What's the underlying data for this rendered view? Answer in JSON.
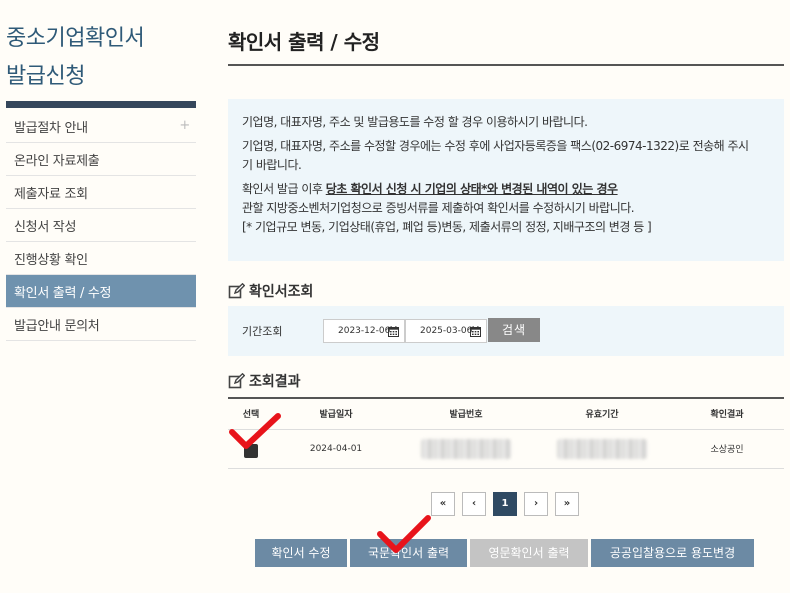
{
  "sidebar": {
    "title_line1": "중소기업확인서",
    "title_line2": "발급신청",
    "plus": "+",
    "items": [
      {
        "label": "발급절차 안내"
      },
      {
        "label": "온라인 자료제출"
      },
      {
        "label": "제출자료 조회"
      },
      {
        "label": "신청서 작성"
      },
      {
        "label": "진행상황 확인"
      },
      {
        "label": "확인서 출력 / 수정"
      },
      {
        "label": "발급안내 문의처"
      }
    ]
  },
  "main": {
    "title": "확인서 출력 / 수정",
    "notice": {
      "p1": "기업명, 대표자명, 주소 및 발급용도를 수정 할 경우 이용하시기 바랍니다.",
      "p2_line1": "기업명, 대표자명, 주소를 수정할 경우에는 수정 후에 사업자등록증을 팩스(02-6974-1322)로 전송해 주시",
      "p2_line2": "기 바랍니다.",
      "p3_prefix": "확인서 발급 이후 ",
      "p3_bold": "당초 확인서 신청 시 기업의 상태*와 변경된 내역이 있는 경우",
      "p3_line2": "관할 지방중소벤처기업청으로 증빙서류를 제출하여 확인서를 수정하시기 바랍니다.",
      "p3_line3": "[* 기업규모 변동, 기업상태(휴업, 폐업 등)변동, 제출서류의 정정, 지배구조의 변경 등 ]"
    },
    "search": {
      "section_title": "확인서조회",
      "label": "기간조회",
      "date_from": "2023-12-06",
      "date_to": "2025-03-06",
      "button": "검색"
    },
    "results": {
      "section_title": "조회결과",
      "columns": [
        "선택",
        "발급일자",
        "발급번호",
        "유효기간",
        "확인결과"
      ],
      "rows": [
        {
          "issue_date": "2024-04-01",
          "result": "소상공인"
        }
      ]
    },
    "pagination": {
      "first": "«",
      "prev": "‹",
      "current": "1",
      "next": "›",
      "last": "»"
    },
    "actions": {
      "edit": "확인서 수정",
      "print_korean": "국문확인서 출력",
      "print_english": "영문확인서 출력",
      "change_purpose": "공공입찰용으로 용도변경"
    }
  },
  "colors": {
    "accent": "#6c8aa4",
    "check_mark": "#e8141b",
    "sidebar_active": "#6f92ae",
    "notice_bg": "#eef6fa"
  }
}
